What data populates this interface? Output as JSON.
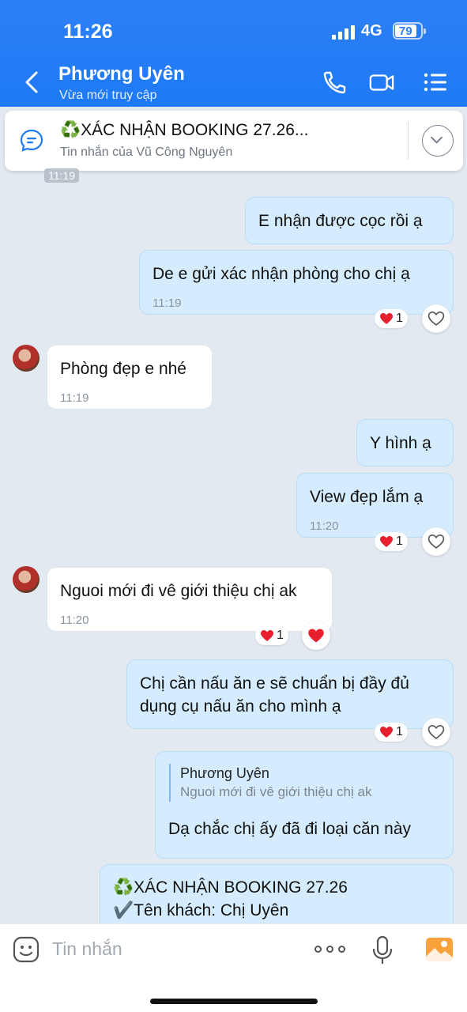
{
  "status_bar": {
    "time": "11:26",
    "network": "4G",
    "battery": "79"
  },
  "header": {
    "contact_name": "Phương Uyên",
    "contact_status": "Vừa mới truy cập"
  },
  "pinned": {
    "title": "♻️XÁC NHẬN BOOKING 27.26...",
    "subtitle": "Tin nhắn của Vũ Công Nguyên"
  },
  "top_time": "11:19",
  "messages": [
    {
      "side": "out",
      "text": "E nhận được cọc rồi ạ"
    },
    {
      "side": "out",
      "text": "De e gửi xác nhận phòng cho chị ạ",
      "time": "11:19",
      "reaction_count": "1"
    },
    {
      "side": "in",
      "text": "Phòng đẹp e nhé",
      "time": "11:19"
    },
    {
      "side": "out",
      "text": "Y hình ạ"
    },
    {
      "side": "out",
      "text": "View đẹp lắm ạ",
      "time": "11:20",
      "reaction_count": "1"
    },
    {
      "side": "in",
      "text": "Nguoi mới đi vê giới thiệu chị ak",
      "time": "11:20",
      "reaction_count": "1"
    },
    {
      "side": "out",
      "line1": "Chị cần nấu ăn e sẽ chuẩn bị đầy đủ",
      "line2": "dụng cụ nấu ăn cho mình ạ",
      "reaction_count": "1"
    },
    {
      "side": "out",
      "quote_name": "Phương Uyên",
      "quote_text": "Nguoi mới đi vê giới thiệu chị ak",
      "text": "Dạ chắc chị ấy đã đi loại căn này"
    },
    {
      "side": "out",
      "line1": "♻️XÁC NHẬN BOOKING 27.26",
      "line2": "✔️Tên khách: Chị Uyên"
    }
  ],
  "composer": {
    "placeholder": "Tin nhắn"
  },
  "colors": {
    "header_blue": "#1e7af5",
    "bubble_out": "#d4ecfd",
    "chat_bg": "#e2e9f1",
    "heart": "#e8202e"
  }
}
